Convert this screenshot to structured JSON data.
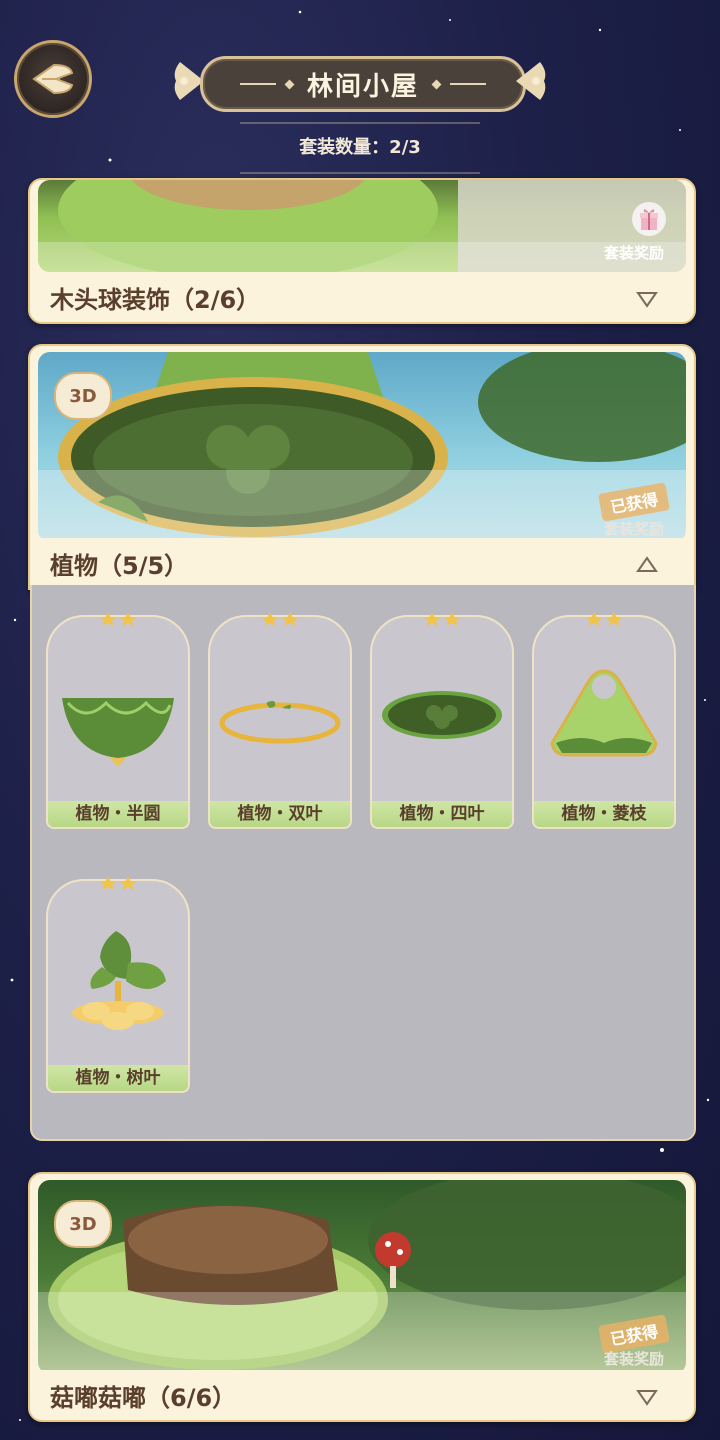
{
  "header": {
    "title": "林间小屋",
    "subtitle": "套装数量：2/3"
  },
  "sets": [
    {
      "name": "木头球装饰（2/6）",
      "reward_label": "套装奖励",
      "expanded": false
    },
    {
      "name": "植物（5/5）",
      "badge": "3D",
      "obtained_label": "已获得",
      "reward_label": "套装奖励",
      "expanded": true,
      "items": [
        {
          "name": "植物・半圆",
          "stars": 2
        },
        {
          "name": "植物・双叶",
          "stars": 2
        },
        {
          "name": "植物・四叶",
          "stars": 2
        },
        {
          "name": "植物・菱枝",
          "stars": 2
        },
        {
          "name": "植物・树叶",
          "stars": 2
        }
      ]
    },
    {
      "name": "菇嘟菇嘟（6/6）",
      "badge": "3D",
      "obtained_label": "已获得",
      "reward_label": "套装奖励",
      "expanded": false
    }
  ],
  "colors": {
    "background": "#1d2048",
    "card": "#fbf3dc",
    "gold": "#e6c987",
    "item_label": "#b7d786"
  }
}
